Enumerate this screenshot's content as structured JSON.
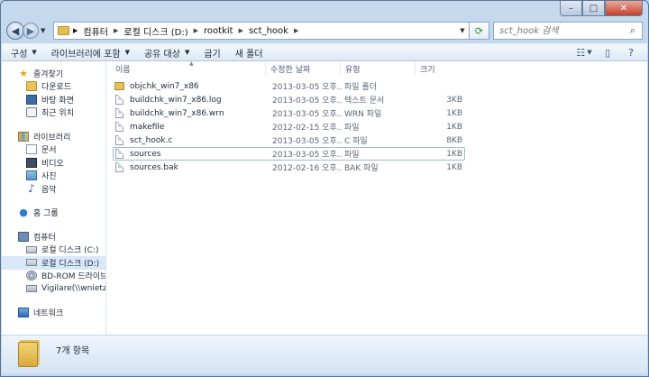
{
  "window": {
    "caption": {
      "minimize": "–",
      "maximize": "□",
      "close": "✕"
    }
  },
  "nav": {
    "back_icon": "back-arrow-icon",
    "forward_icon": "forward-arrow-icon",
    "breadcrumb": [
      "컴퓨터",
      "로컬 디스크 (D:)",
      "rootkit",
      "sct_hook"
    ],
    "search_placeholder": "sct_hook 검색"
  },
  "toolbar": {
    "organize": "구성",
    "include_library": "라이브러리에 포함",
    "share": "공유 대상",
    "burn": "굽기",
    "new_folder": "새 폴더"
  },
  "sidebar": {
    "favorites": {
      "label": "즐겨찾기",
      "items": [
        "다운로드",
        "바탕 화면",
        "최근 위치"
      ]
    },
    "libraries": {
      "label": "라이브러리",
      "items": [
        "문서",
        "비디오",
        "사진",
        "음악"
      ]
    },
    "homegroup": {
      "label": "홈 그룹"
    },
    "computer": {
      "label": "컴퓨터",
      "items": [
        "로컬 디스크 (C:)",
        "로컬 디스크 (D:)",
        "BD-ROM 드라이브 (",
        "Vigilare(\\\\wnietzsch"
      ]
    },
    "network": {
      "label": "네트워크"
    }
  },
  "columns": {
    "name": "이름",
    "date": "수정한 날짜",
    "type": "유형",
    "size": "크기"
  },
  "files": [
    {
      "name": "objchk_win7_x86",
      "date": "2013-03-05 오후...",
      "type": "파일 폴더",
      "size": "",
      "kind": "folder"
    },
    {
      "name": "buildchk_win7_x86.log",
      "date": "2013-03-05 오후...",
      "type": "텍스트 문서",
      "size": "3KB",
      "kind": "file"
    },
    {
      "name": "buildchk_win7_x86.wrn",
      "date": "2013-03-05 오후...",
      "type": "WRN 파일",
      "size": "1KB",
      "kind": "file"
    },
    {
      "name": "makefile",
      "date": "2012-02-15 오후...",
      "type": "파일",
      "size": "1KB",
      "kind": "file"
    },
    {
      "name": "sct_hook.c",
      "date": "2013-03-05 오후...",
      "type": "C 파일",
      "size": "8KB",
      "kind": "file"
    },
    {
      "name": "sources",
      "date": "2013-03-05 오후...",
      "type": "파일",
      "size": "1KB",
      "kind": "file"
    },
    {
      "name": "sources.bak",
      "date": "2012-02-16 오후...",
      "type": "BAK 파일",
      "size": "1KB",
      "kind": "file"
    }
  ],
  "details": {
    "item_count": "7개 항목"
  }
}
